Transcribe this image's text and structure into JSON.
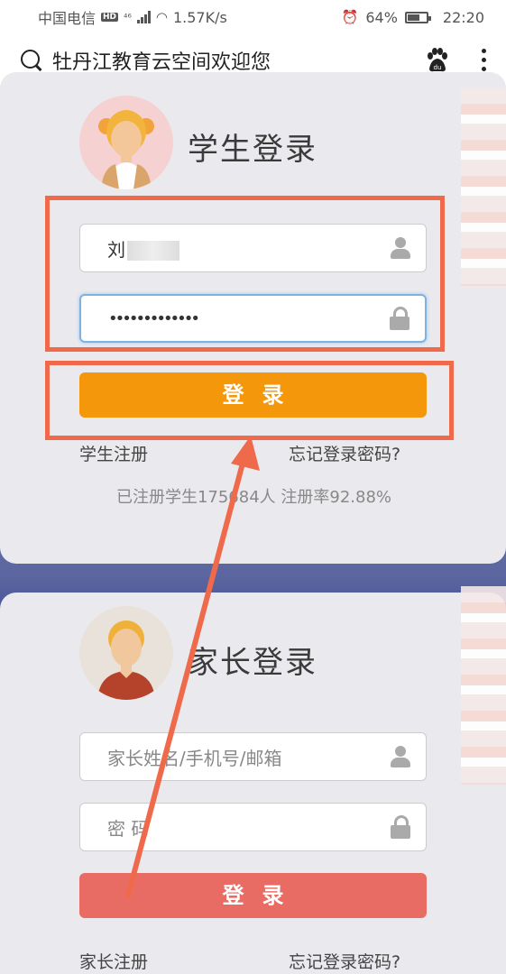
{
  "status_bar": {
    "carrier": "中国电信",
    "hd": "HD",
    "network": "⁴⁶",
    "speed": "1.57K/s",
    "battery": "64%",
    "time": "22:20"
  },
  "browser": {
    "page_title": "牡丹江教育云空间欢迎您"
  },
  "student_login": {
    "heading": "学生登录",
    "username_value": "刘",
    "password_value": "•••••••••••••",
    "login_button": "登录",
    "register_link": "学生注册",
    "forgot_link": "忘记登录密码?",
    "stats": "已注册学生175684人 注册率92.88%"
  },
  "parent_login": {
    "heading": "家长登录",
    "username_placeholder": "家长姓名/手机号/邮箱",
    "password_placeholder": "密 码",
    "login_button": "登录",
    "register_link": "家长注册",
    "forgot_link": "忘记登录密码?"
  },
  "colors": {
    "student_button": "#f5970a",
    "parent_button": "#e86c64",
    "highlight": "#ee6a4a"
  }
}
